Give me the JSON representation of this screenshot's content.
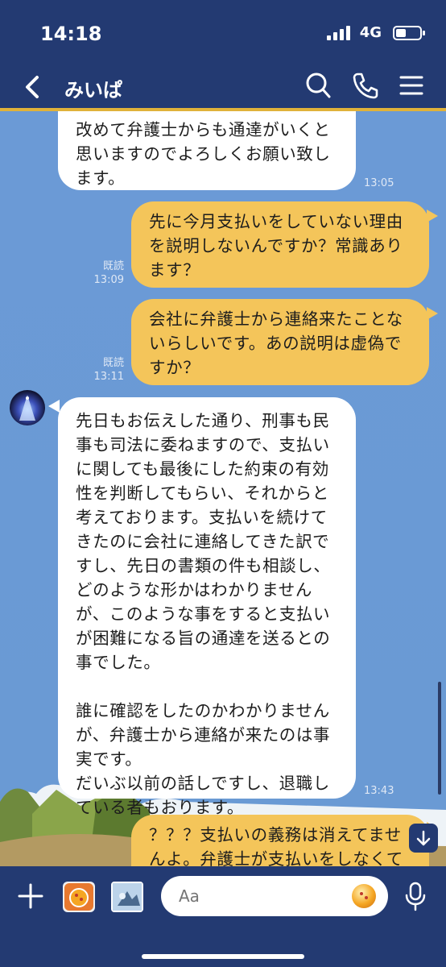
{
  "status": {
    "time": "14:18",
    "network": "4G"
  },
  "header": {
    "chat_name": "みいぱ"
  },
  "messages": {
    "m1": {
      "text": "改めて弁護士からも通達がいくと\n思いますのでよろしくお願い致し\nます。",
      "time": "13:05"
    },
    "m2": {
      "text": "先に今月支払いをしていない理由\nを説明しないんですか？常識あり\nます？",
      "read": "既読",
      "time": "13:09"
    },
    "m3": {
      "text": "会社に弁護士から連絡来たことな\nいらしいです。あの説明は虚偽で\nすか？",
      "read": "既読",
      "time": "13:11"
    },
    "m4": {
      "text": "先日もお伝えした通り、刑事も民\n事も司法に委ねますので、支払い\nに関しても最後にした約束の有効\n性を判断してもらい、それからと\n考えております。支払いを続けて\nきたのに会社に連絡してきた訳で\nすし、先日の書類の件も相談し、\nどのような形かはわかりません\nが、このような事をすると支払い\nが困難になる旨の通達を送るとの\n事でした。\n\n誰に確認をしたのかわかりません\nが、弁護士から連絡が来たのは事\n実です。\nだいぶ以前の話しですし、退職し\nている者もおります。",
      "time": "13:43"
    },
    "m5": {
      "text": "？？？支払いの義務は消えてませ\nんよ。弁護士が支払いをしなくて"
    }
  },
  "input": {
    "placeholder": "Aa"
  },
  "colors": {
    "header": "#233a72",
    "accent": "#e0b23a",
    "chat_bg": "#6a98d3",
    "outgoing": "#f4c55a",
    "incoming": "#ffffff"
  },
  "icons": {
    "back": "chevron-left-icon",
    "search": "search-icon",
    "call": "phone-icon",
    "menu": "hamburger-menu-icon",
    "add": "plus-icon",
    "camera": "camera-icon",
    "image": "image-icon",
    "sticker": "sticker-icon",
    "mic": "microphone-icon",
    "scroll": "arrow-down-icon"
  }
}
